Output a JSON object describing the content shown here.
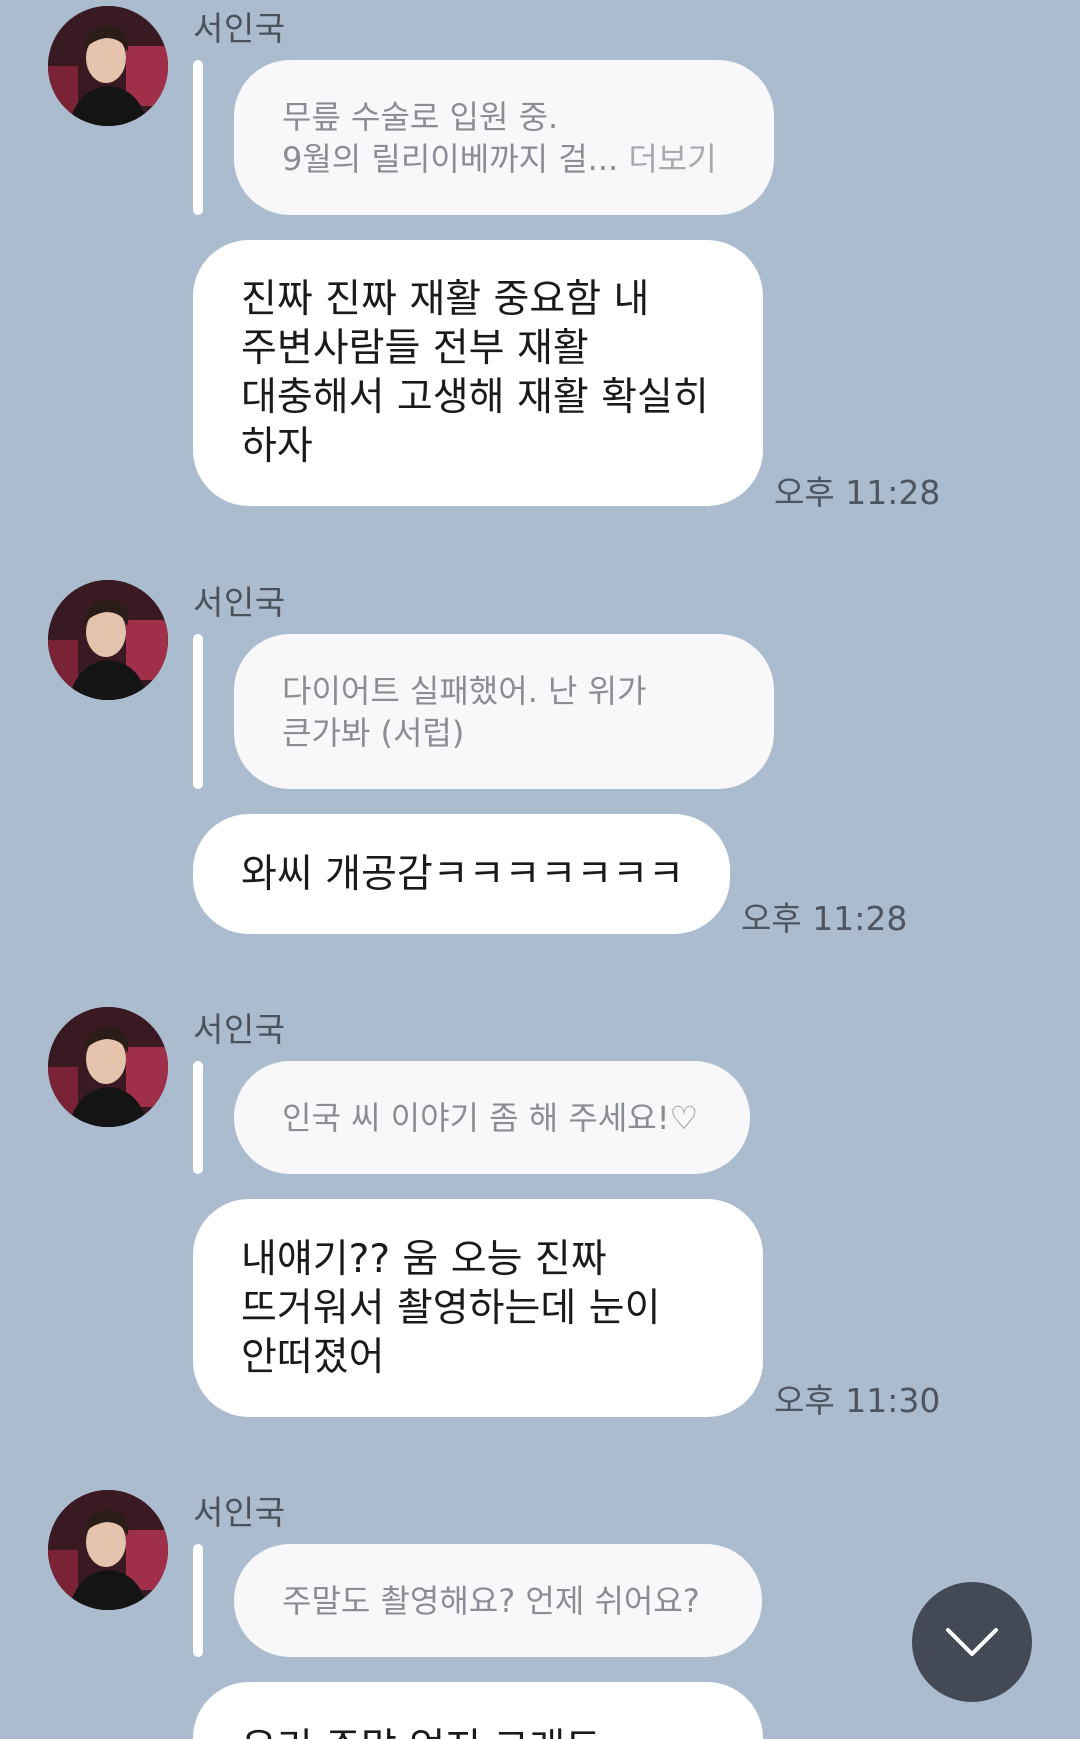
{
  "messages": [
    {
      "sender": "서인국",
      "quote_lines": [
        "무릎 수술로 입원 중.",
        "9월의 릴리이베까지 걸..."
      ],
      "quote_more": "더보기",
      "reply_lines": [
        "진짜 진짜 재활 중요함 내",
        "주변사람들 전부 재활",
        "대충해서 고생해 재활 확실히",
        "하자"
      ],
      "time": "오후 11:28"
    },
    {
      "sender": "서인국",
      "quote_lines": [
        "다이어트 실패했어. 난 위가",
        "큰가봐 (서럽)"
      ],
      "reply_lines": [
        "와씨 개공감ㅋㅋㅋㅋㅋㅋㅋ"
      ],
      "time": "오후 11:28"
    },
    {
      "sender": "서인국",
      "quote_lines": [
        "인국 씨 이야기 좀 해 주세요!♡"
      ],
      "reply_lines": [
        "내얘기?? 움 오능 진짜",
        "뜨거워서 촬영하는데 눈이",
        "안떠졌어"
      ],
      "time": "오후 11:30"
    },
    {
      "sender": "서인국",
      "quote_lines": [
        "주말도 촬영해요? 언제 쉬어요?"
      ],
      "reply_lines": [
        "우리 주말 없지 그래도"
      ]
    }
  ],
  "colors": {
    "background": "#abbccf",
    "bubble": "#ffffff",
    "quote_bubble": "#f8f8fa",
    "scroll_button": "#434a56"
  },
  "icons": {
    "scroll_down": "chevron-down-icon"
  }
}
